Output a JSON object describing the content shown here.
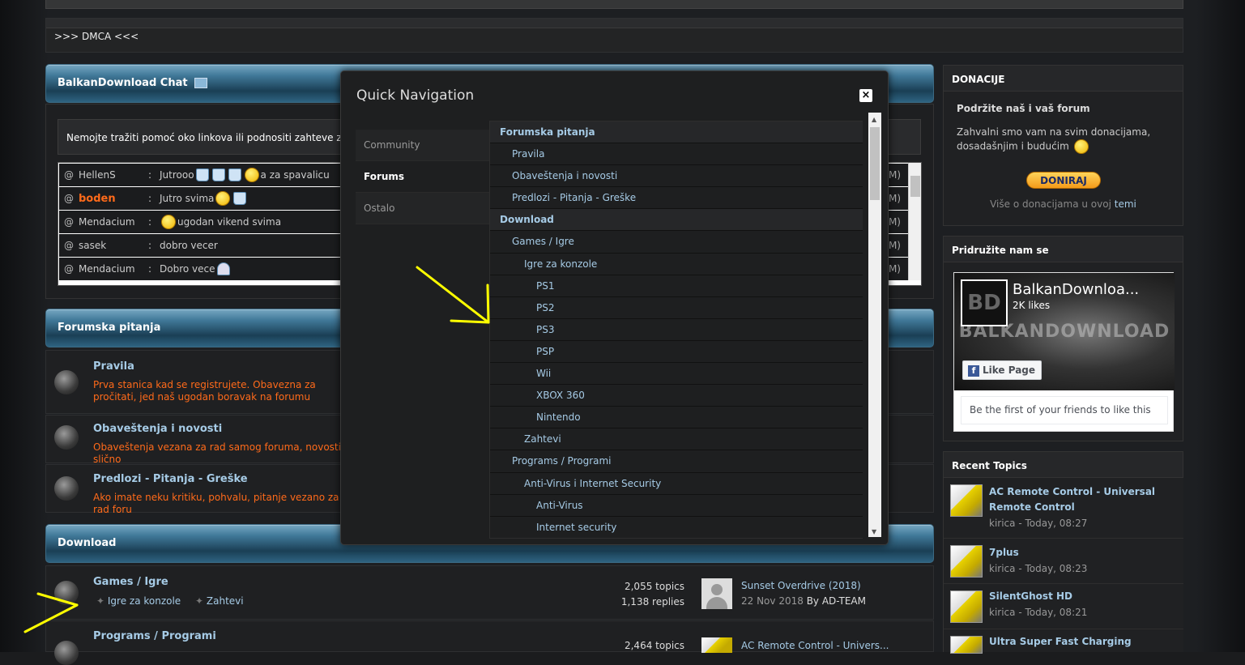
{
  "dmca": ">>> DMCA <<<",
  "chat": {
    "title": "BalkanDownload Chat",
    "notice": "Nemojte tražiti pomoć oko linkova ili podnositi zahteve za o",
    "rows": [
      {
        "user": "HellenS",
        "message": "Jutrooo",
        "tail": "a za spavalicu",
        "time": "AM)"
      },
      {
        "user": "boden",
        "message": "Jutro svima",
        "tail": "",
        "time": "AM)"
      },
      {
        "user": "Mendacium",
        "message": "ugodan vikend svima",
        "tail": "",
        "time": "PM)"
      },
      {
        "user": "sasek",
        "message": "dobro vecer",
        "tail": "",
        "time": "PM)"
      },
      {
        "user": "Mendacium",
        "message": "Dobro vece",
        "tail": "",
        "time": "PM)"
      }
    ]
  },
  "forumska": {
    "header": "Forumska pitanja",
    "forums": [
      {
        "title": "Pravila",
        "desc": "Prva stanica kad se registrujete. Obavezna za pročitati, jed naš ugodan boravak na forumu"
      },
      {
        "title": "Obaveštenja i novosti",
        "desc": "Obaveštenja vezana za rad samog foruma, novosti, i slično"
      },
      {
        "title": "Predlozi - Pitanja - Greške",
        "desc": "Ako imate neku kritiku, pohvalu, pitanje vezano za rad foru"
      }
    ]
  },
  "download": {
    "header": "Download",
    "forums": [
      {
        "title": "Games / Igre",
        "sub1": "Igre za konzole",
        "sub2": "Zahtevi",
        "topics": "2,055 topics",
        "replies": "1,138 replies",
        "last_title": "Sunset Overdrive (2018)",
        "last_date": "22 Nov 2018",
        "last_by": "By AD-TEAM"
      },
      {
        "title": "Programs / Programi",
        "topics": "2,464 topics",
        "last_title": "AC Remote Control - Univers..."
      }
    ]
  },
  "donacije": {
    "header": "DONACIJE",
    "title": "Podržite naš i vaš forum",
    "text": "Zahvalni smo vam na svim donacijama, dosadašnjim i budućim",
    "button": "DONIRAJ",
    "more": "Više o donacijama u ovoj",
    "more_link": "temi"
  },
  "join": {
    "header": "Pridružite nam se",
    "page_name": "BalkanDownloa...",
    "likes": "2K likes",
    "like_button": "Like Page",
    "friends": "Be the first of your friends to like this",
    "logo_text": "BALKANDOWNLOAD",
    "logo_initials": "BD"
  },
  "recent": {
    "header": "Recent Topics",
    "topics": [
      {
        "title": "AC Remote Control - Universal Remote Control",
        "meta": "kirica - Today, 08:27"
      },
      {
        "title": "7plus",
        "meta": "kirica - Today, 08:23"
      },
      {
        "title": "SilentGhost HD",
        "meta": "kirica - Today, 08:21"
      },
      {
        "title": "Ultra Super Fast Charging",
        "meta": ""
      }
    ]
  },
  "modal": {
    "title": "Quick Navigation",
    "close": "×",
    "tabs": [
      "Community",
      "Forums",
      "Ostalo"
    ],
    "items": [
      {
        "label": "Forumska pitanja",
        "level": 0
      },
      {
        "label": "Pravila",
        "level": 1
      },
      {
        "label": "Obaveštenja i novosti",
        "level": 1
      },
      {
        "label": "Predlozi - Pitanja - Greške",
        "level": 1
      },
      {
        "label": "Download",
        "level": 0
      },
      {
        "label": "Games / Igre",
        "level": 1
      },
      {
        "label": "Igre za konzole",
        "level": 2
      },
      {
        "label": "PS1",
        "level": 3
      },
      {
        "label": "PS2",
        "level": 3
      },
      {
        "label": "PS3",
        "level": 3
      },
      {
        "label": "PSP",
        "level": 3
      },
      {
        "label": "Wii",
        "level": 3
      },
      {
        "label": "XBOX 360",
        "level": 3
      },
      {
        "label": "Nintendo",
        "level": 3
      },
      {
        "label": "Zahtevi",
        "level": 2
      },
      {
        "label": "Programs / Programi",
        "level": 1
      },
      {
        "label": "Anti-Virus i Internet Security",
        "level": 2
      },
      {
        "label": "Anti-Virus",
        "level": 3
      },
      {
        "label": "Internet security",
        "level": 3
      }
    ]
  },
  "colors": {
    "link": "#a6cbe6",
    "desc": "#ff6a1a",
    "arrow": "#ffff00",
    "accent": "#3f7797"
  }
}
